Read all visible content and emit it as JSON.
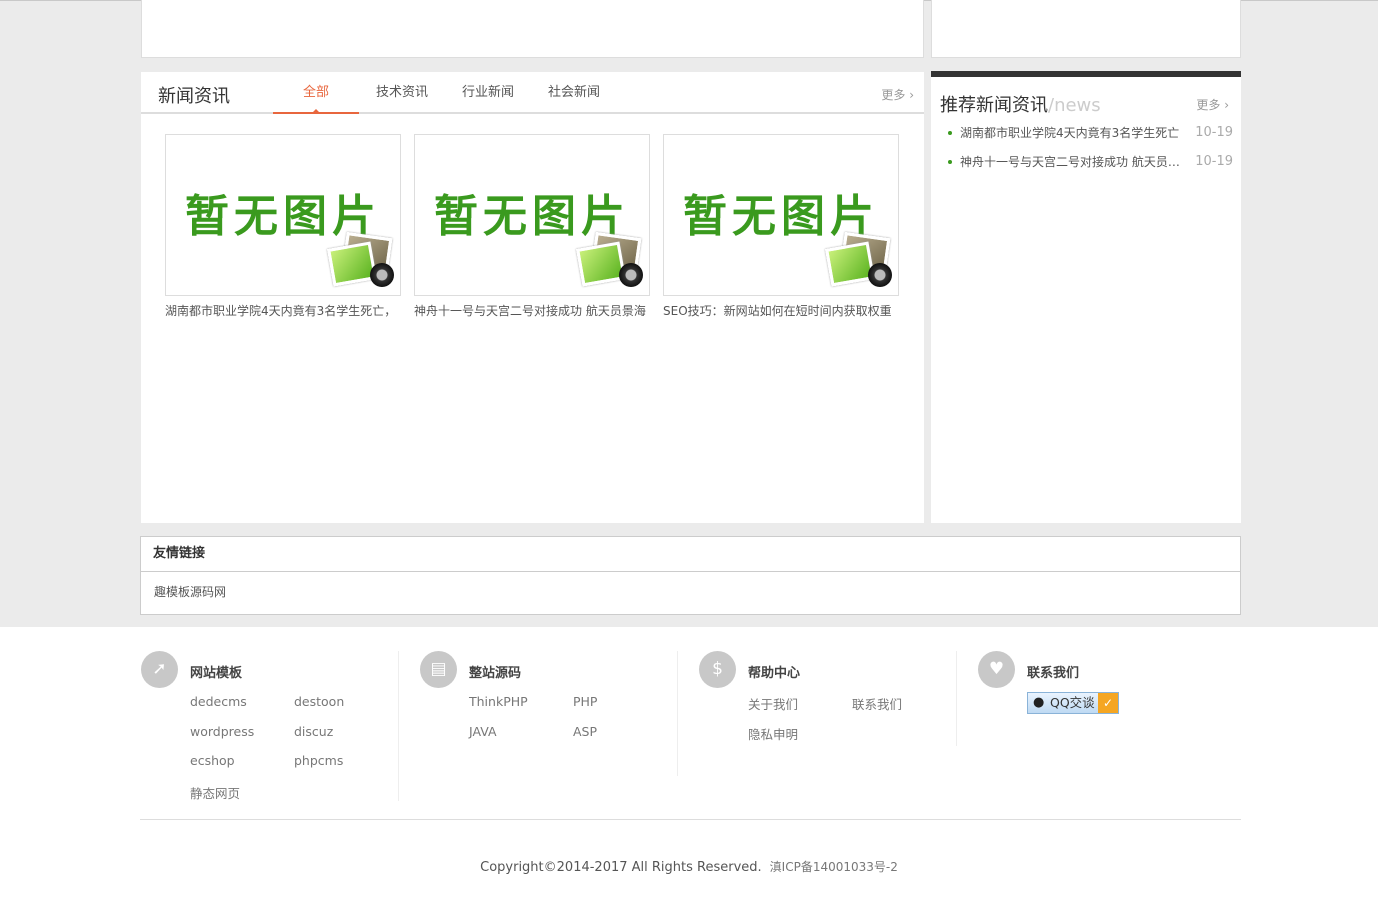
{
  "news": {
    "title": "新闻资讯",
    "tabs": [
      {
        "label": "全部"
      },
      {
        "label": "技术资讯"
      },
      {
        "label": "行业新闻"
      },
      {
        "label": "社会新闻"
      }
    ],
    "more_label": "更多",
    "placeholder_text": "暂无图片",
    "cards": [
      {
        "caption": "湖南都市职业学院4天内竟有3名学生死亡，"
      },
      {
        "caption": "神舟十一号与天宫二号对接成功 航天员景海"
      },
      {
        "caption": "SEO技巧：新网站如何在短时间内获取权重"
      }
    ]
  },
  "recommend": {
    "title": "推荐新闻资讯",
    "title_en": "/news",
    "more_label": "更多",
    "items": [
      {
        "text": "湖南都市职业学院4天内竟有3名学生死亡",
        "date": "10-19"
      },
      {
        "text": "神舟十一号与天宫二号对接成功 航天员景海鹏",
        "date": "10-19"
      }
    ]
  },
  "friend_links": {
    "title": "友情链接",
    "items": [
      "趣模板源码网"
    ]
  },
  "footer": {
    "columns": [
      {
        "title": "网站模板",
        "icon": "compass-icon",
        "links": [
          "dedecms",
          "destoon",
          "wordpress",
          "discuz",
          "ecshop",
          "phpcms",
          "静态网页"
        ]
      },
      {
        "title": "整站源码",
        "icon": "store-icon",
        "links": [
          "ThinkPHP",
          "PHP",
          "JAVA",
          "ASP"
        ]
      },
      {
        "title": "帮助中心",
        "icon": "dollar-icon",
        "links": [
          "关于我们",
          "联系我们",
          "隐私申明"
        ]
      },
      {
        "title": "联系我们",
        "icon": "heart-icon",
        "qq_label": "QQ交谈"
      }
    ],
    "copyright": "Copyright©2014-2017 All Rights Reserved.",
    "icp": "滇ICP备14001033号-2"
  },
  "colors": {
    "accent": "#e8663d",
    "bullet": "#3a9a1e",
    "dark_bar": "#333333"
  }
}
